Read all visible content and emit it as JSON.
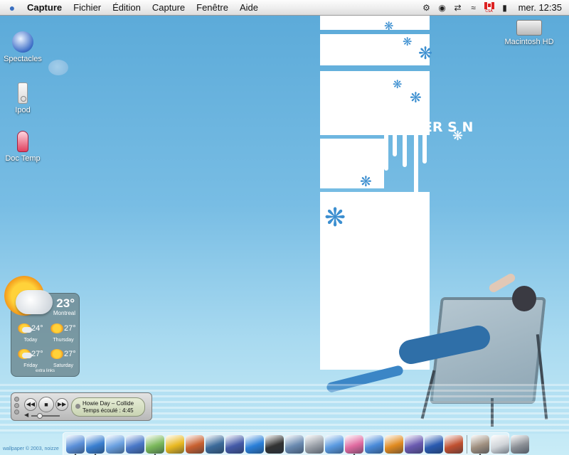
{
  "menubar": {
    "apple_icon": "apple-icon",
    "app_name": "Capture",
    "items": [
      "Fichier",
      "Édition",
      "Capture",
      "Fenêtre",
      "Aide"
    ],
    "extras": [
      "gear-icon",
      "script-icon",
      "vpn-icon",
      "wifi-icon",
      "canada-flag-icon",
      "battery-icon"
    ],
    "flag_caption": "CSA",
    "clock": "mer. 12:35"
  },
  "wallpaper": {
    "headline": "SUMMER S  N",
    "credit": "wallpaper © 2003, noizze"
  },
  "desktop": {
    "icons": [
      {
        "label": "Spectacles",
        "icon": "spectacles-icon"
      },
      {
        "label": "Ipod",
        "icon": "ipod-icon"
      },
      {
        "label": "Doc Temp",
        "icon": "doc-temp-icon"
      },
      {
        "label": "Macintosh HD",
        "icon": "hard-drive-icon"
      }
    ]
  },
  "weather": {
    "current_temp": "23°",
    "city": "Montreal",
    "forecast": [
      {
        "day": "Today",
        "temp": "24°",
        "icon": "partly-cloudy-icon"
      },
      {
        "day": "Thursday",
        "temp": "27°",
        "icon": "sunny-icon"
      },
      {
        "day": "Friday",
        "temp": "27°",
        "icon": "partly-cloudy-icon"
      },
      {
        "day": "Saturday",
        "temp": "27°",
        "icon": "sunny-icon"
      }
    ],
    "links": "extra links"
  },
  "player": {
    "track": "Howie Day – Collide",
    "elapsed": "Temps écoulé : 4:45",
    "volume_fraction": 0.3
  },
  "dock": {
    "apps": [
      {
        "name": "finder",
        "color": "#5a8fd8",
        "running": true
      },
      {
        "name": "safari",
        "color": "#3a7fd0",
        "running": true
      },
      {
        "name": "mail",
        "color": "#6aa0e0",
        "running": false
      },
      {
        "name": "preview",
        "color": "#4a78c8",
        "running": false
      },
      {
        "name": "itunes",
        "color": "#7ab85a",
        "running": true
      },
      {
        "name": "caution",
        "color": "#e8b820",
        "running": false
      },
      {
        "name": "home",
        "color": "#c86030",
        "running": false
      },
      {
        "name": "eye",
        "color": "#3c6a9a",
        "running": false
      },
      {
        "name": "imovie",
        "color": "#445aa8",
        "running": false
      },
      {
        "name": "quicktime",
        "color": "#2a7fd8",
        "running": false
      },
      {
        "name": "clapper",
        "color": "#333333",
        "running": false
      },
      {
        "name": "screenshot",
        "color": "#6a8ab0",
        "running": false
      },
      {
        "name": "system",
        "color": "#9aa0a8",
        "running": false
      },
      {
        "name": "messenger",
        "color": "#5a9ae0",
        "running": false
      },
      {
        "name": "app-pink",
        "color": "#e06aa0",
        "running": true
      },
      {
        "name": "word",
        "color": "#4a8ad8",
        "running": false
      },
      {
        "name": "orange-face",
        "color": "#e08a20",
        "running": false
      },
      {
        "name": "shield",
        "color": "#6a5ab0",
        "running": false
      },
      {
        "name": "ring",
        "color": "#2a5ab0",
        "running": false
      },
      {
        "name": "tools",
        "color": "#c05030",
        "running": false
      },
      {
        "name": "script",
        "color": "#a09080",
        "running": true
      },
      {
        "name": "document",
        "color": "#d0d4d8",
        "running": false
      },
      {
        "name": "trash",
        "color": "#8c9096",
        "running": false
      }
    ]
  }
}
